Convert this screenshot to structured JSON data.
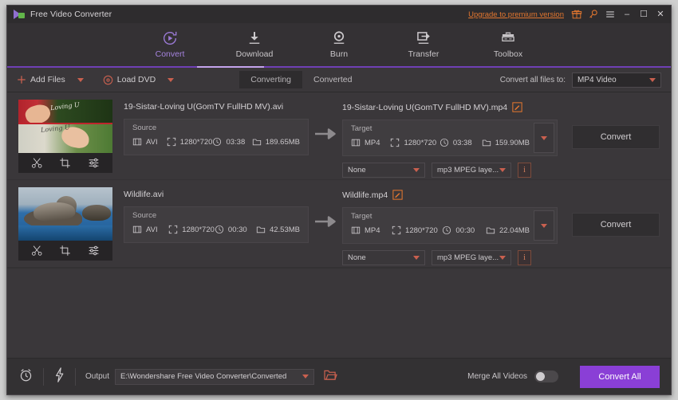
{
  "window": {
    "title": "Free Video Converter",
    "upgrade_link": "Upgrade to premium version",
    "icons": {
      "gift": "gift-icon",
      "key": "key-icon",
      "menu": "hamburger-menu-icon"
    },
    "controls": {
      "minimize": "–",
      "maximize": "☐",
      "close": "✕"
    }
  },
  "nav": {
    "items": [
      {
        "label": "Convert",
        "icon": "convert-icon",
        "active": true
      },
      {
        "label": "Download",
        "icon": "download-icon",
        "active": false
      },
      {
        "label": "Burn",
        "icon": "burn-icon",
        "active": false
      },
      {
        "label": "Transfer",
        "icon": "transfer-icon",
        "active": false
      },
      {
        "label": "Toolbox",
        "icon": "toolbox-icon",
        "active": false
      }
    ],
    "accent_color": "#6f3fb5"
  },
  "toolbar": {
    "add_files": "Add Files",
    "load_dvd": "Load DVD",
    "tabs": [
      {
        "label": "Converting",
        "active": true
      },
      {
        "label": "Converted",
        "active": false
      }
    ],
    "convert_all_to_label": "Convert all files to:",
    "convert_all_to_value": "MP4 Video"
  },
  "labels": {
    "source": "Source",
    "target": "Target",
    "convert": "Convert"
  },
  "files": [
    {
      "source_name": "19-Sistar-Loving U(GomTV FullHD MV).avi",
      "source": {
        "format": "AVI",
        "resolution": "1280*720",
        "duration": "03:38",
        "size": "189.65MB"
      },
      "target_name": "19-Sistar-Loving U(GomTV FullHD MV).mp4",
      "target": {
        "format": "MP4",
        "resolution": "1280*720",
        "duration": "03:38",
        "size": "159.90MB"
      },
      "subtitle": "None",
      "audio": "mp3 MPEG laye...",
      "convert_button": "Convert",
      "thumb_tools": [
        "trim-icon",
        "crop-icon",
        "effect-icon"
      ]
    },
    {
      "source_name": "Wildlife.avi",
      "source": {
        "format": "AVI",
        "resolution": "1280*720",
        "duration": "00:30",
        "size": "42.53MB"
      },
      "target_name": "Wildlife.mp4",
      "target": {
        "format": "MP4",
        "resolution": "1280*720",
        "duration": "00:30",
        "size": "22.04MB"
      },
      "subtitle": "None",
      "audio": "mp3 MPEG laye...",
      "convert_button": "Convert",
      "thumb_tools": [
        "trim-icon",
        "crop-icon",
        "effect-icon"
      ]
    }
  ],
  "bottom": {
    "timer_icon": "alarm-clock-icon",
    "accelerate_icon": "lightning-icon",
    "output_label": "Output",
    "output_path": "E:\\Wondershare Free Video Converter\\Converted",
    "folder_icon": "open-folder-icon",
    "merge_label": "Merge All Videos",
    "merge_enabled": false,
    "convert_all_button": "Convert All",
    "convert_all_color": "#8a3fd6"
  },
  "thumb_art": {
    "one_script_a": "Loving U",
    "one_script_b": "Loving U"
  }
}
